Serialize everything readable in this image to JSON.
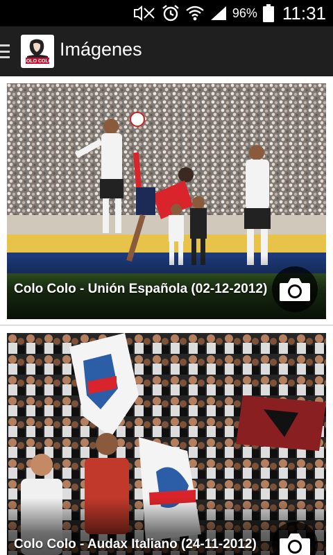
{
  "status_bar": {
    "battery_percent": "96%",
    "time": "11:31",
    "icons": [
      "mute-icon",
      "alarm-icon",
      "wifi-icon",
      "signal-icon",
      "battery-icon"
    ]
  },
  "app_bar": {
    "title": "Imágenes",
    "logo_text": "COLO COLO"
  },
  "gallery": {
    "items": [
      {
        "title": "Colo Colo - Unión Española (02-12-2012)"
      },
      {
        "title": "Colo Colo - Audax Italiano (24-11-2012)"
      }
    ]
  },
  "colors": {
    "status_bar_bg": "#000000",
    "app_bar_bg": "#1f1f1f",
    "background": "#ececec",
    "card_bg": "#ffffff",
    "camera_button_bg": "#000000"
  }
}
